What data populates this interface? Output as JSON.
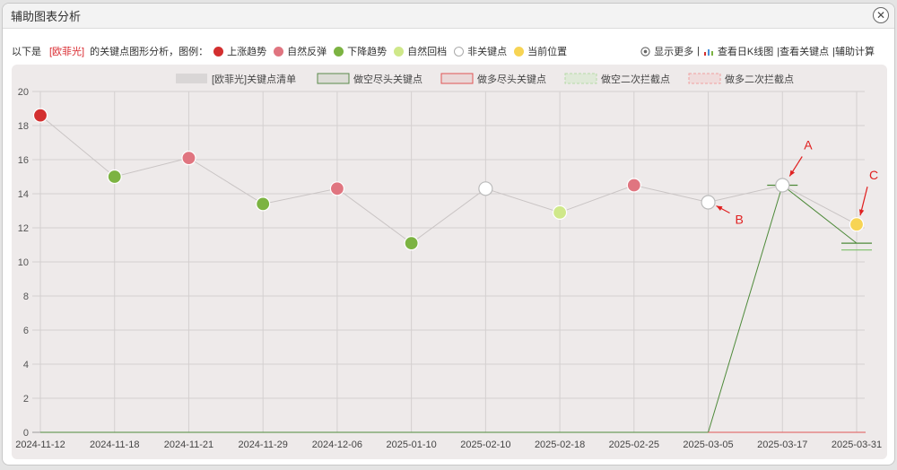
{
  "modal": {
    "title": "辅助图表分析"
  },
  "legend_bar": {
    "intro": "以下是",
    "stock": "[欧菲光]",
    "desc": "的关键点图形分析，图例：",
    "items": [
      {
        "label": "上涨趋势",
        "color": "#d32f2f"
      },
      {
        "label": "自然反弹",
        "color": "#e07580"
      },
      {
        "label": "下降趋势",
        "color": "#7cb342"
      },
      {
        "label": "自然回档",
        "color": "#cfe88a"
      },
      {
        "label": "非关键点",
        "color": "#ffffff"
      },
      {
        "label": "当前位置",
        "color": "#f7d454"
      }
    ]
  },
  "tools": {
    "show_more": "显示更多",
    "sep1": "|",
    "kline": "查看日K线图",
    "key_points": "|查看关键点",
    "calc": "|辅助计算"
  },
  "chart_data": {
    "type": "line",
    "legend": [
      {
        "name": "[欧菲光]关键点清单",
        "color": "#d9d6d6"
      },
      {
        "name": "做空尽头关键点",
        "color": "#5a8a4a"
      },
      {
        "name": "做多尽头关键点",
        "color": "#e05555"
      },
      {
        "name": "做空二次拦截点",
        "color": "#b7d9a8"
      },
      {
        "name": "做多二次拦截点",
        "color": "#f0a0a0"
      }
    ],
    "categories": [
      "2024-11-12",
      "2024-11-18",
      "2024-11-21",
      "2024-11-29",
      "2024-12-06",
      "2025-01-10",
      "2025-02-10",
      "2025-02-18",
      "2025-02-25",
      "2025-03-05",
      "2025-03-17",
      "2025-03-31"
    ],
    "series": [
      {
        "name": "[欧菲光]关键点清单",
        "values": [
          18.6,
          15.0,
          16.1,
          13.4,
          14.3,
          11.1,
          14.3,
          12.9,
          14.5,
          13.5,
          14.5,
          12.2
        ],
        "point_colors": [
          "#d32f2f",
          "#7cb342",
          "#e07580",
          "#7cb342",
          "#e07580",
          "#7cb342",
          "#ffffff",
          "#cfe88a",
          "#e07580",
          "#ffffff",
          "#ffffff",
          "#f7d454"
        ]
      },
      {
        "name": "做空尽头关键点",
        "values": [
          0,
          0,
          0,
          0,
          0,
          0,
          0,
          0,
          0,
          0,
          14.5,
          11.1
        ]
      },
      {
        "name": "做多尽头关键点",
        "values": [
          0,
          0,
          0,
          0,
          0,
          0,
          0,
          0,
          0,
          0,
          0,
          0
        ]
      }
    ],
    "horizontal_marks": [
      {
        "x_index": 10,
        "value": 14.5
      },
      {
        "x_index": 11,
        "value": 11.1
      },
      {
        "x_index": 11,
        "value": 10.7
      }
    ],
    "ylim": [
      0,
      20
    ],
    "yticks": [
      0,
      2,
      4,
      6,
      8,
      10,
      12,
      14,
      16,
      18,
      20
    ],
    "grid": true,
    "annotations": [
      {
        "label": "A",
        "x_index": 10,
        "value": 14.5,
        "color": "#e02020"
      },
      {
        "label": "B",
        "x_index": 9,
        "value": 13.5,
        "color": "#e02020"
      },
      {
        "label": "C",
        "x_index": 11,
        "value": 12.2,
        "color": "#e02020"
      }
    ]
  }
}
